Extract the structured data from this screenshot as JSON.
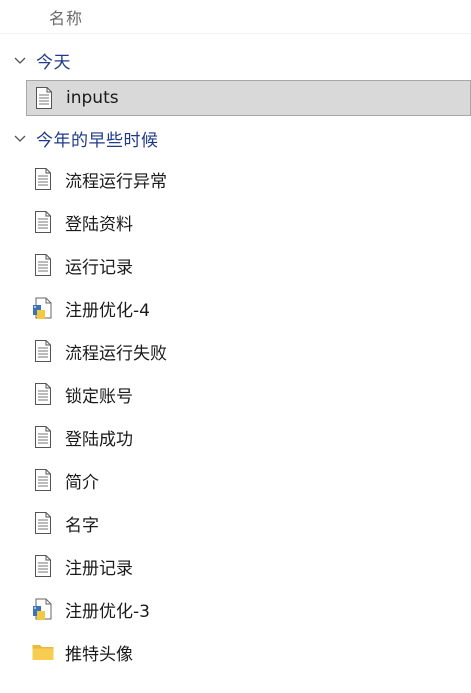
{
  "header": {
    "name_column": "名称"
  },
  "groups": [
    {
      "label": "今天",
      "items": [
        {
          "name": "inputs",
          "icon": "document-icon",
          "selected": true
        }
      ]
    },
    {
      "label": "今年的早些时候",
      "items": [
        {
          "name": "流程运行异常",
          "icon": "document-icon"
        },
        {
          "name": "登陆资料",
          "icon": "document-icon"
        },
        {
          "name": "运行记录",
          "icon": "document-icon"
        },
        {
          "name": "注册优化-4",
          "icon": "python-file-icon"
        },
        {
          "name": "流程运行失败",
          "icon": "document-icon"
        },
        {
          "name": "锁定账号",
          "icon": "document-icon"
        },
        {
          "name": "登陆成功",
          "icon": "document-icon"
        },
        {
          "name": "简介",
          "icon": "document-icon"
        },
        {
          "name": "名字",
          "icon": "document-icon"
        },
        {
          "name": "注册记录",
          "icon": "document-icon"
        },
        {
          "name": "注册优化-3",
          "icon": "python-file-icon"
        },
        {
          "name": "推特头像",
          "icon": "folder-icon"
        }
      ]
    }
  ],
  "colors": {
    "group_label": "#1f3a8a",
    "selected_bg": "#d9d9d9",
    "selected_border": "#a7a7a7",
    "folder": "#f3c94b"
  }
}
